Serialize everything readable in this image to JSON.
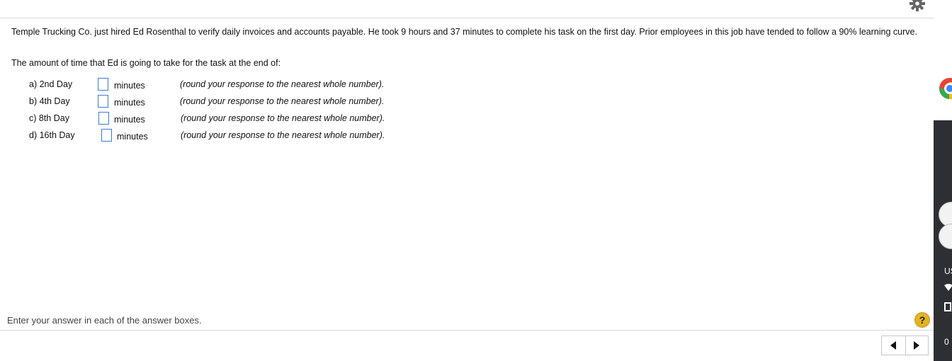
{
  "question": {
    "text": "Temple Trucking Co. just hired Ed Rosenthal to verify daily invoices and accounts payable. He took 9 hours and 37 minutes to complete his task on the first day.  Prior employees in this job have tended to follow a 90% learning curve.",
    "prompt": "The amount of time that Ed is going to take for the task at the end of:"
  },
  "rows": [
    {
      "label": "a) 2nd Day",
      "value": "",
      "unit": "minutes",
      "hint": "(round your response to the nearest whole number)."
    },
    {
      "label": "b) 4th Day",
      "value": "",
      "unit": "minutes",
      "hint": "(round your response to the nearest whole number)."
    },
    {
      "label": "c) 8th Day",
      "value": "",
      "unit": "minutes",
      "hint": "(round your response to the nearest whole number)."
    },
    {
      "label": "d) 16th Day",
      "value": "",
      "unit": "minutes",
      "hint": "(round your response to the nearest whole number)."
    }
  ],
  "footer": {
    "instruction": "Enter your answer in each of the answer boxes.",
    "help_symbol": "?"
  },
  "icons": {
    "settings": "gear-icon",
    "help": "question-icon",
    "previous": "triangle-left-icon",
    "next": "triangle-right-icon"
  },
  "colors": {
    "input_border": "#3a7bd5",
    "help_badge": "#e3b323"
  },
  "side_panel": {
    "label": "US",
    "number": "0"
  }
}
